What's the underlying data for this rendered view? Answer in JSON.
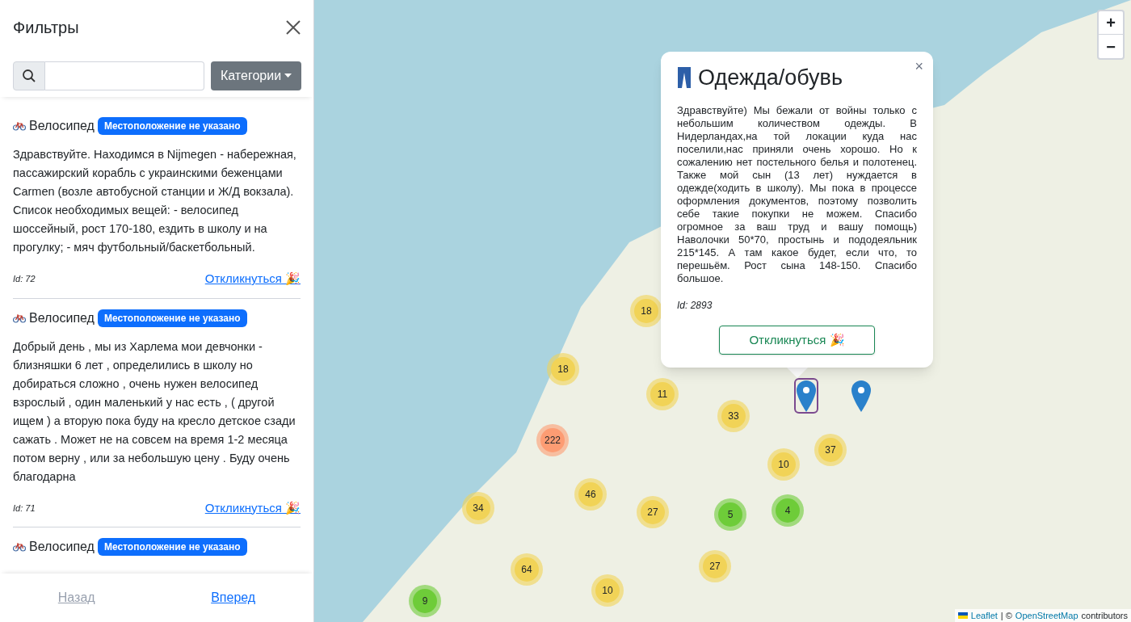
{
  "sidebar": {
    "title": "Фильтры",
    "categories_button": "Категории",
    "items": [
      {
        "title": "Велосипед",
        "badge": "Местоположение не указано",
        "text": "Здравствуйте. Находимся в Nijmegen - набережная, пассажирский корабль с украинскими беженцами Carmen (возле автобусной станции и Ж/Д вокзала). Список необходимых вещей: - велосипед шоссейный, рост 170-180, ездить в школу и на прогулку; - мяч футбольный/баскетбольный.",
        "id": "Id: 72",
        "link": "Откликнуться 🎉"
      },
      {
        "title": "Велосипед",
        "badge": "Местоположение не указано",
        "text": "Добрый день , мы из Харлема мои девчонки - близняшки 6 лет , определились в школу но добираться сложно , очень нужен велосипед взрослый , один маленький у нас есть , ( другой ищем ) а вторую пока буду на кресло детское сзади сажать . Может не на совсем на время 1-2 месяца потом верну , или за небольшую цену . Буду очень благодарна",
        "id": "Id: 71",
        "link": "Откликнуться 🎉"
      },
      {
        "title": "Велосипед",
        "badge": "Местоположение не указано"
      }
    ],
    "pager": [
      {
        "label": "Назад",
        "disabled": true
      },
      {
        "label": "Вперед",
        "disabled": false
      }
    ]
  },
  "map": {
    "zoom_in": "+",
    "zoom_out": "−",
    "clusters": [
      {
        "count": "18",
        "color": "#f1d357"
      },
      {
        "count": "18",
        "color": "#f1d357"
      },
      {
        "count": "11",
        "color": "#f1d357"
      },
      {
        "count": "33",
        "color": "#f1d357"
      },
      {
        "count": "222",
        "color": "#fd9c73"
      },
      {
        "count": "37",
        "color": "#f1d357"
      },
      {
        "count": "10",
        "color": "#f1d357"
      },
      {
        "count": "46",
        "color": "#f1d357"
      },
      {
        "count": "34",
        "color": "#f1d357"
      },
      {
        "count": "27",
        "color": "#f1d357"
      },
      {
        "count": "5",
        "color": "#6ecc39"
      },
      {
        "count": "4",
        "color": "#6ecc39"
      },
      {
        "count": "64",
        "color": "#f1d357"
      },
      {
        "count": "27",
        "color": "#f1d357"
      },
      {
        "count": "10",
        "color": "#f1d357"
      },
      {
        "count": "9",
        "color": "#6ecc39"
      }
    ],
    "markers": [
      {
        "selected": true
      },
      {
        "selected": false
      }
    ],
    "popup": {
      "close": "×",
      "title": "Одежда/обувь",
      "text": "Здравствуйте) Мы бежали от войны только с небольшим количеством одежды. В Нидерландах,на той локации куда нас поселили,нас приняли очень хорошо. Но к сожалению нет постельного белья и полотенец. Также мой сын (13 лет) нуждается в одежде(ходить в школу). Мы пока в процессе оформления документов, поэтому позволить себе такие покупки не можем. Спасибо огромное за ваш труд и вашу помощь) Наволочки 50*70, простынь и пододеяльник 215*145. А там какое будет, если что, то перешьём. Рост сына 148-150. Спасибо большое.",
      "id": "Id: 2893",
      "button": "Откликнуться 🎉"
    },
    "attribution": {
      "leaflet": "Leaflet",
      "separator": "| ©",
      "osm": "OpenStreetMap",
      "suffix": "contributors"
    }
  }
}
